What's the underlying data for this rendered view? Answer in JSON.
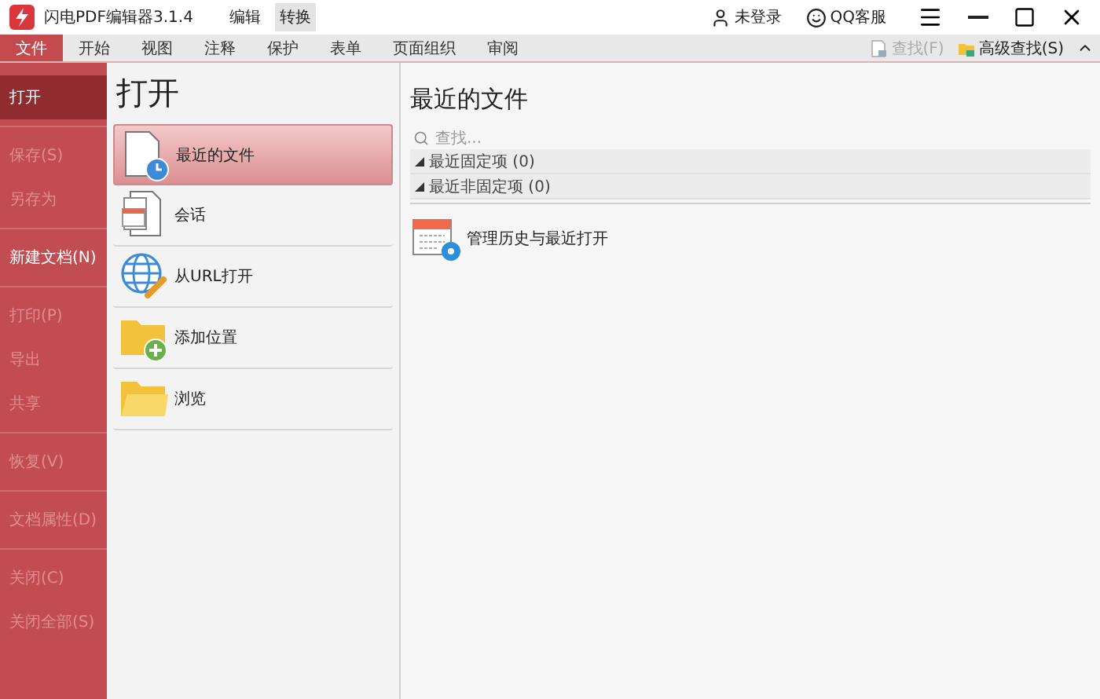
{
  "window": {
    "title": "闪电PDF编辑器3.1.4",
    "modes": [
      {
        "label": "编辑",
        "selected": false
      },
      {
        "label": "转换",
        "selected": true
      }
    ],
    "account": "未登录",
    "support": "QQ客服"
  },
  "ribbon": {
    "tabs": [
      {
        "label": "文件",
        "selected": true
      },
      {
        "label": "开始",
        "selected": false
      },
      {
        "label": "视图",
        "selected": false
      },
      {
        "label": "注释",
        "selected": false
      },
      {
        "label": "保护",
        "selected": false
      },
      {
        "label": "表单",
        "selected": false
      },
      {
        "label": "页面组织",
        "selected": false
      },
      {
        "label": "审阅",
        "selected": false
      }
    ],
    "tools": [
      {
        "label": "查找(F)",
        "disabled": true
      },
      {
        "label": "高级查找(S)",
        "disabled": false
      }
    ]
  },
  "sidebar": {
    "groups": [
      [
        {
          "label": "打开",
          "selected": true,
          "disabled": false
        }
      ],
      [
        {
          "label": "保存(S)",
          "selected": false,
          "disabled": true
        },
        {
          "label": "另存为",
          "selected": false,
          "disabled": true
        }
      ],
      [
        {
          "label": "新建文档(N)",
          "selected": false,
          "disabled": false
        }
      ],
      [
        {
          "label": "打印(P)",
          "selected": false,
          "disabled": true
        },
        {
          "label": "导出",
          "selected": false,
          "disabled": true
        },
        {
          "label": "共享",
          "selected": false,
          "disabled": true
        }
      ],
      [
        {
          "label": "恢复(V)",
          "selected": false,
          "disabled": true
        }
      ],
      [
        {
          "label": "文档属性(D)",
          "selected": false,
          "disabled": true
        }
      ],
      [
        {
          "label": "关闭(C)",
          "selected": false,
          "disabled": true
        },
        {
          "label": "关闭全部(S)",
          "selected": false,
          "disabled": true
        }
      ]
    ]
  },
  "open_panel": {
    "title": "打开",
    "items": [
      {
        "kind": "recent",
        "label": "最近的文件",
        "selected": true
      },
      {
        "kind": "session",
        "label": "会话",
        "selected": false
      },
      {
        "kind": "url",
        "label": "从URL打开",
        "selected": false
      },
      {
        "kind": "add",
        "label": "添加位置",
        "selected": false
      },
      {
        "kind": "browse",
        "label": "浏览",
        "selected": false
      }
    ]
  },
  "recent_panel": {
    "title": "最近的文件",
    "search": {
      "placeholder": "查找..."
    },
    "groups": [
      {
        "label": "最近固定项 (0)",
        "expanded": true
      },
      {
        "label": "最近非固定项 (0)",
        "expanded": true
      }
    ],
    "manage": "管理历史与最近打开"
  }
}
